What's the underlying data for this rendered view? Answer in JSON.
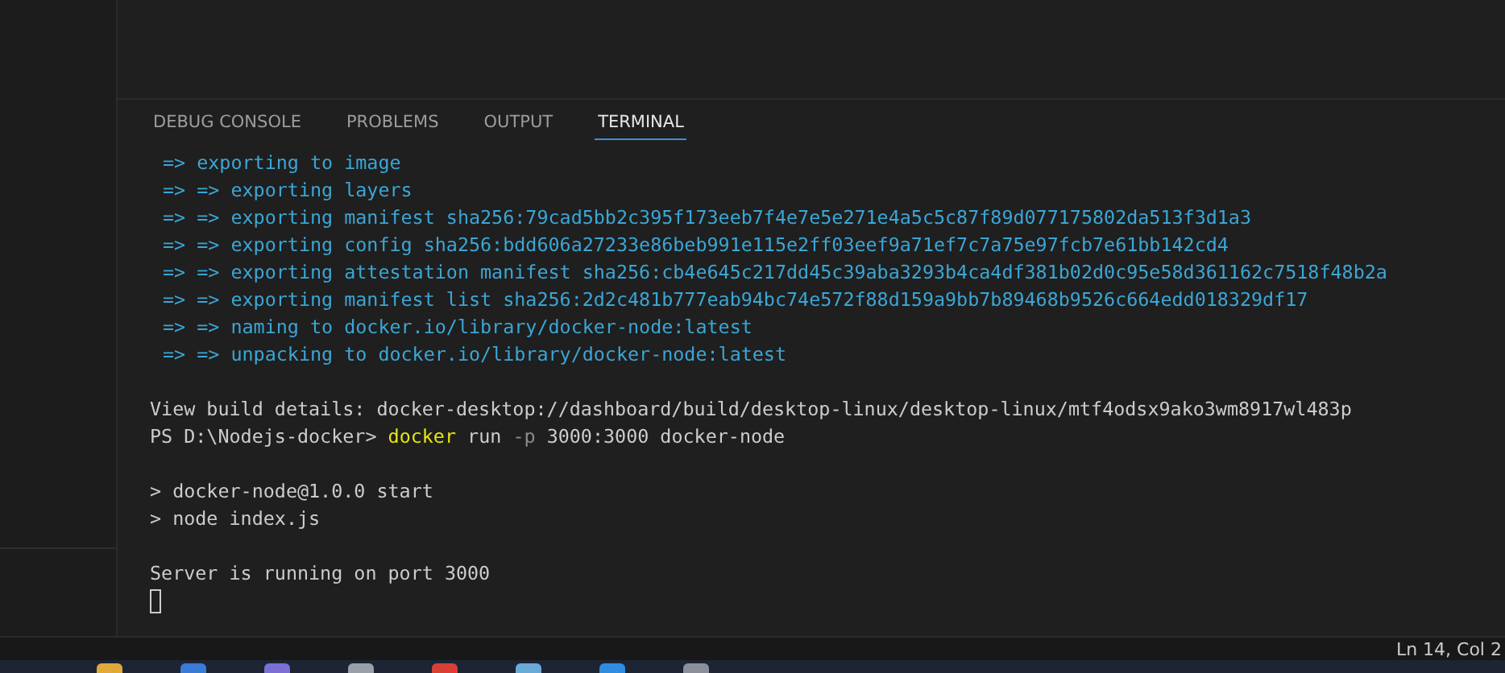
{
  "panel": {
    "tabs": [
      {
        "label": "DEBUG CONSOLE",
        "selected": false
      },
      {
        "label": "PROBLEMS",
        "selected": false
      },
      {
        "label": "OUTPUT",
        "selected": false
      },
      {
        "label": "TERMINAL",
        "selected": true
      }
    ]
  },
  "terminal": {
    "lines": [
      {
        "kind": "build",
        "segments": [
          {
            "kind": "text",
            "text": "=> exporting to image"
          }
        ]
      },
      {
        "kind": "build",
        "segments": [
          {
            "kind": "text",
            "text": "=> => exporting layers"
          }
        ]
      },
      {
        "kind": "build",
        "segments": [
          {
            "kind": "text",
            "text": "=> => exporting manifest sha256:79cad5bb2c395f173eeb7f4e7e5e271e4a5c5c87f89d077175802da513f3d1a3"
          }
        ]
      },
      {
        "kind": "build",
        "segments": [
          {
            "kind": "text",
            "text": "=> => exporting config sha256:bdd606a27233e86beb991e115e2ff03eef9a71ef7c7a75e97fcb7e61bb142cd4"
          }
        ]
      },
      {
        "kind": "build",
        "segments": [
          {
            "kind": "text",
            "text": "=> => exporting attestation manifest sha256:cb4e645c217dd45c39aba3293b4ca4df381b02d0c95e58d361162c7518f48b2a"
          }
        ]
      },
      {
        "kind": "build",
        "segments": [
          {
            "kind": "text",
            "text": "=> => exporting manifest list sha256:2d2c481b777eab94bc74e572f88d159a9bb7b89468b9526c664edd018329df17"
          }
        ]
      },
      {
        "kind": "build",
        "segments": [
          {
            "kind": "text",
            "text": "=> => naming to docker.io/library/docker-node:latest"
          }
        ]
      },
      {
        "kind": "build",
        "segments": [
          {
            "kind": "text",
            "text": "=> => unpacking to docker.io/library/docker-node:latest"
          }
        ]
      },
      {
        "kind": "blank"
      },
      {
        "kind": "plain",
        "segments": [
          {
            "kind": "text",
            "text": "View build details: docker-desktop://dashboard/build/desktop-linux/desktop-linux/mtf4odsx9ako3wm8917wl483p"
          }
        ]
      },
      {
        "kind": "plain",
        "segments": [
          {
            "kind": "text",
            "text": "PS D:\\Nodejs-docker> "
          },
          {
            "kind": "command",
            "text": "docker"
          },
          {
            "kind": "text",
            "text": " run "
          },
          {
            "kind": "flag",
            "text": "-p"
          },
          {
            "kind": "text",
            "text": " 3000:3000 docker-node"
          }
        ]
      },
      {
        "kind": "blank"
      },
      {
        "kind": "plain",
        "segments": [
          {
            "kind": "text",
            "text": "> docker-node@1.0.0 start"
          }
        ]
      },
      {
        "kind": "plain",
        "segments": [
          {
            "kind": "text",
            "text": "> node index.js"
          }
        ]
      },
      {
        "kind": "blank"
      },
      {
        "kind": "plain",
        "segments": [
          {
            "kind": "text",
            "text": "Server is running on port 3000"
          }
        ]
      },
      {
        "kind": "cursor"
      }
    ]
  },
  "status_bar": {
    "position": "Ln 14, Col 2"
  }
}
